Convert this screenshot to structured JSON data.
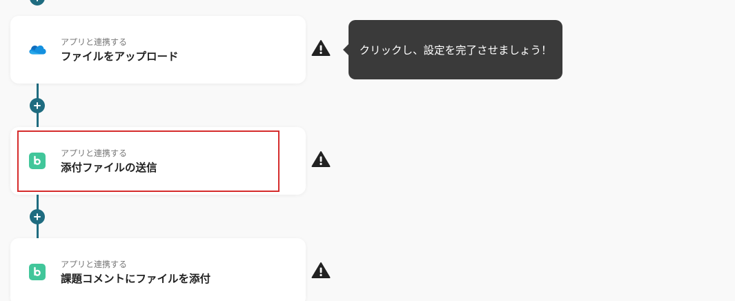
{
  "colors": {
    "connector": "#1f6c80",
    "highlight": "#d52b2b",
    "tooltip_bg": "#3a3a3a",
    "backlog_green": "#41c69a",
    "onedrive_blue": "#0f6cbd"
  },
  "steps": [
    {
      "caption": "アプリと連携する",
      "title": "ファイルをアップロード",
      "icon": "onedrive-icon",
      "warning": true
    },
    {
      "caption": "アプリと連携する",
      "title": "添付ファイルの送信",
      "icon": "backlog-icon",
      "warning": true,
      "highlighted": true
    },
    {
      "caption": "アプリと連携する",
      "title": "課題コメントにファイルを添付",
      "icon": "backlog-icon",
      "warning": true
    }
  ],
  "tooltip": {
    "text": "クリックし、設定を完了させましょう！"
  },
  "add_step_icon": "plus-icon",
  "warning_icon": "warning-triangle-icon"
}
